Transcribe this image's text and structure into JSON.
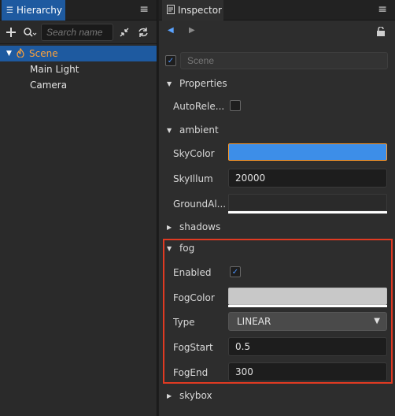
{
  "hierarchy": {
    "tab_label": "Hierarchy",
    "search_placeholder": "Search name",
    "tree": [
      {
        "label": "Scene",
        "selected": true
      },
      {
        "label": "Main Light"
      },
      {
        "label": "Camera"
      }
    ]
  },
  "inspector": {
    "tab_label": "Inspector",
    "node_name": "Scene",
    "sections": {
      "properties": "Properties",
      "ambient": "ambient",
      "shadows": "shadows",
      "fog": "fog",
      "skybox": "skybox"
    },
    "properties": {
      "autorelease_label": "AutoRele..."
    },
    "ambient": {
      "skycolor_label": "SkyColor",
      "skycolor": "#3d8ee8",
      "skyillum_label": "SkyIllum",
      "skyillum_value": "20000",
      "groundalbedo_label": "GroundAl...",
      "groundalbedo": "#2a2a2a"
    },
    "fog": {
      "enabled_label": "Enabled",
      "enabled": true,
      "fogcolor_label": "FogColor",
      "fogcolor": "#c8c8c8",
      "type_label": "Type",
      "type_value": "LINEAR",
      "fogstart_label": "FogStart",
      "fogstart_value": "0.5",
      "fogend_label": "FogEnd",
      "fogend_value": "300"
    }
  },
  "icons": {
    "menu": "hamburger-menu-icon",
    "add": "plus-icon",
    "search": "search-icon",
    "collapse": "collapse-icon",
    "refresh": "refresh-icon",
    "back": "back-arrow-icon",
    "forward": "forward-arrow-icon",
    "lock": "lock-icon"
  },
  "colors": {
    "accent": "#1e5aa0",
    "scene_label": "#ffa23a",
    "highlight_box": "#e03a22"
  }
}
